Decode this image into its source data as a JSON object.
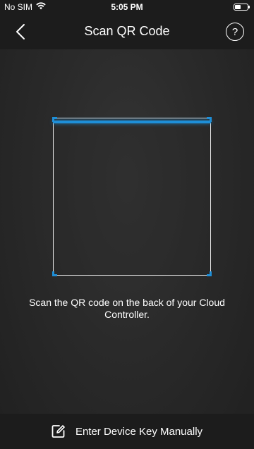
{
  "status_bar": {
    "carrier": "No SIM",
    "time": "5:05 PM",
    "wifi_icon": "wifi-icon",
    "battery_icon": "battery-icon"
  },
  "nav": {
    "title": "Scan QR Code",
    "back_icon": "chevron-left-icon",
    "help_label": "?"
  },
  "scanner": {
    "accent_color": "#1e8fd8",
    "instruction": "Scan the QR code on the back of your Cloud Controller."
  },
  "bottom": {
    "manual_entry_label": "Enter Device Key Manually",
    "manual_entry_icon": "edit-icon"
  }
}
